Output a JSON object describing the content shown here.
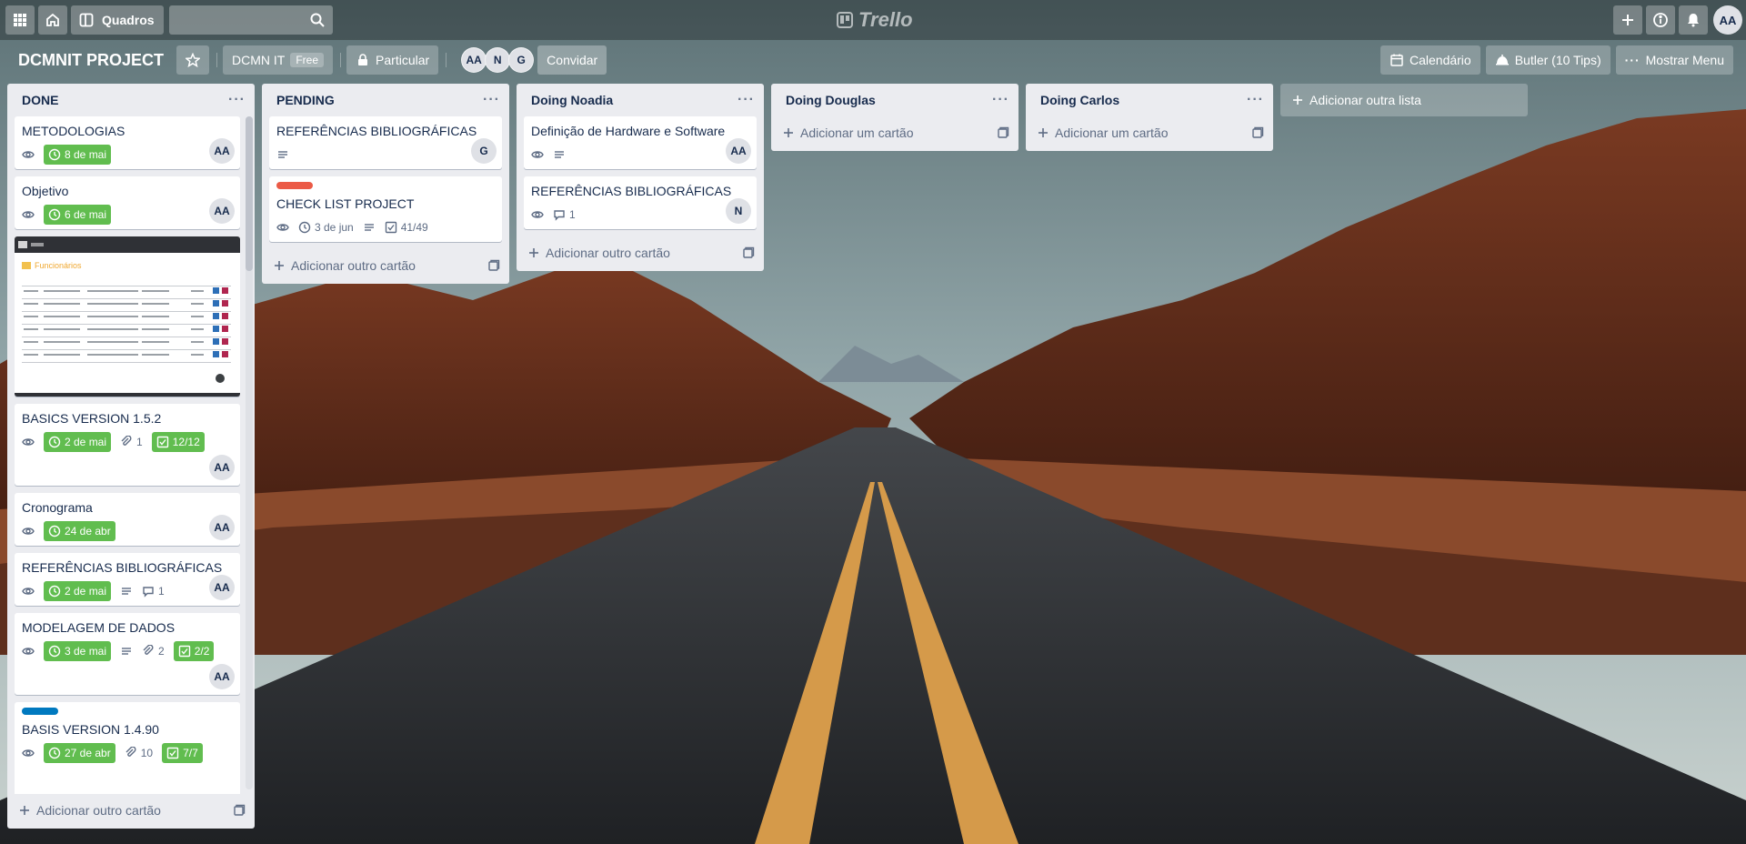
{
  "header": {
    "boards_label": "Quadros",
    "logo_text": "Trello",
    "user_initials": "AA"
  },
  "board": {
    "title": "DCMNIT PROJECT",
    "team_name": "DCMN IT",
    "team_badge": "Free",
    "visibility": "Particular",
    "members": [
      "AA",
      "N",
      "G"
    ],
    "invite_label": "Convidar",
    "calendar_label": "Calendário",
    "butler_label": "Butler (10 Tips)",
    "menu_label": "Mostrar Menu"
  },
  "lists": [
    {
      "title": "DONE",
      "add_label": "Adicionar outro cartão",
      "cards": [
        {
          "title": "METODOLOGIAS",
          "date": "8 de mai",
          "member": "AA"
        },
        {
          "title": "Objetivo",
          "date": "6 de mai",
          "member": "AA"
        },
        {
          "cover_heading": "Funcionários"
        },
        {
          "title": "BASICS VERSION 1.5.2",
          "date": "2 de mai",
          "attachments": "1",
          "checklist": "12/12",
          "member": "AA"
        },
        {
          "title": "Cronograma",
          "date": "24 de abr",
          "member": "AA"
        },
        {
          "title": "REFERÊNCIAS BIBLIOGRÁFICAS",
          "date": "2 de mai",
          "comments": "1",
          "member": "AA"
        },
        {
          "title": "MODELAGEM DE DADOS",
          "date": "3 de mai",
          "attachments": "2",
          "checklist": "2/2",
          "member": "AA"
        },
        {
          "title": "BASIS VERSION 1.4.90",
          "label_color": "#0079bf",
          "date": "27 de abr",
          "attachments": "10",
          "checklist": "7/7"
        }
      ]
    },
    {
      "title": "PENDING",
      "add_label": "Adicionar outro cartão",
      "cards": [
        {
          "title": "REFERÊNCIAS BIBLIOGRÁFICAS",
          "member": "G"
        },
        {
          "title": "CHECK LIST PROJECT",
          "label_color": "#eb5a46",
          "date": "3 de jun",
          "checklist": "41/49"
        }
      ]
    },
    {
      "title": "Doing Noadia",
      "add_label": "Adicionar outro cartão",
      "cards": [
        {
          "title": "Definição de Hardware e Software",
          "member": "AA"
        },
        {
          "title": "REFERÊNCIAS BIBLIOGRÁFICAS",
          "comments": "1",
          "member": "N"
        }
      ]
    },
    {
      "title": "Doing Douglas",
      "add_label": "Adicionar um cartão"
    },
    {
      "title": "Doing Carlos",
      "add_label": "Adicionar um cartão"
    }
  ],
  "add_list_label": "Adicionar outra lista"
}
